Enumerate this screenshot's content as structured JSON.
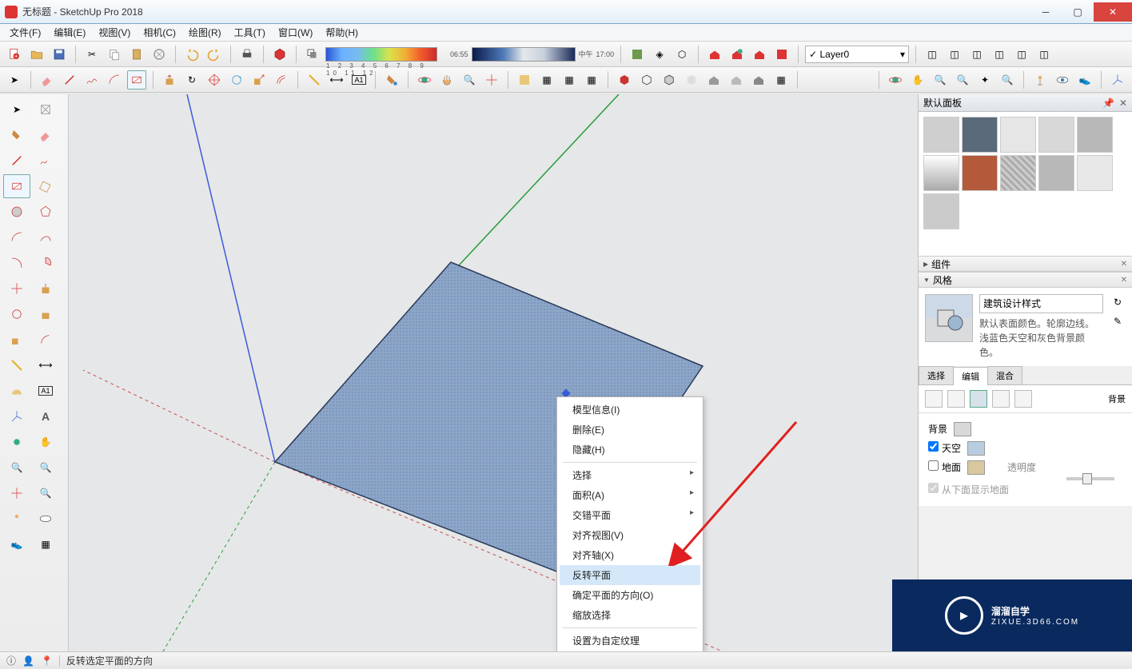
{
  "title": "无标题 - SketchUp Pro 2018",
  "menubar": [
    "文件(F)",
    "编辑(E)",
    "视图(V)",
    "相机(C)",
    "绘图(R)",
    "工具(T)",
    "窗口(W)",
    "帮助(H)"
  ],
  "time_labels": {
    "left": "06:55",
    "mid": "中午",
    "right": "17:00"
  },
  "spectrum_labels": "1 2 3 4 5 6 7 8 9 10 11 12",
  "layer": {
    "current": "Layer0"
  },
  "panels": {
    "default_panel": "默认面板",
    "components": "组件",
    "styles": "风格",
    "style_name": "建筑设计样式",
    "style_desc": "默认表面颜色。轮廓边线。浅蓝色天空和灰色背景颜色。",
    "tabs": [
      "选择",
      "编辑",
      "混合"
    ],
    "bg_label": "背景",
    "background": "背景",
    "sky": "天空",
    "ground": "地面",
    "opacity": "透明度",
    "show_ground": "从下面显示地面"
  },
  "context_menu": {
    "items": [
      {
        "label": "模型信息(I)"
      },
      {
        "label": "删除(E)"
      },
      {
        "label": "隐藏(H)"
      },
      {
        "sep": true
      },
      {
        "label": "选择",
        "sub": true
      },
      {
        "label": "面积(A)",
        "sub": true
      },
      {
        "label": "交错平面",
        "sub": true
      },
      {
        "label": "对齐视图(V)"
      },
      {
        "label": "对齐轴(X)"
      },
      {
        "label": "反转平面",
        "hl": true
      },
      {
        "label": "确定平面的方向(O)"
      },
      {
        "label": "缩放选择"
      },
      {
        "sep": true
      },
      {
        "label": "设置为自定纹理"
      }
    ]
  },
  "statusbar": "反转选定平面的方向",
  "watermark": {
    "main": "溜溜自学",
    "sub": "ZIXUE.3D66.COM"
  },
  "materials": [
    "#c9c9c9",
    "#5b6a7a",
    "#e6e6e6",
    "#d8d8d8",
    "#b8b8b8",
    "#d8d8d8",
    "#b35a3a",
    "#cfcfcf",
    "#b8b8b8",
    "#e8e8e8",
    "#cbcbcb"
  ]
}
